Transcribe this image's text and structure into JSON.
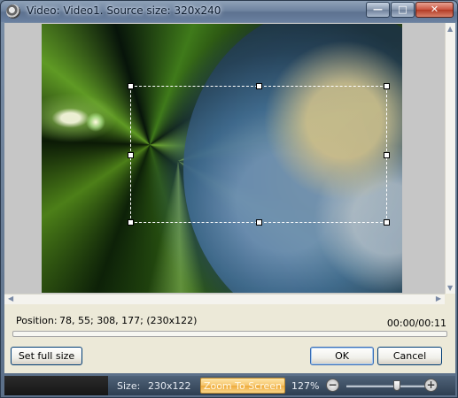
{
  "window": {
    "title": "Video: Video1. Source size: 320x240",
    "minimize_glyph": "—",
    "maximize_glyph": "□",
    "close_glyph": "✕"
  },
  "video": {
    "position_label": "Position:",
    "position_value": "78, 55; 308, 177; (230x122)",
    "time": "00:00/00:11",
    "progress": 0
  },
  "buttons": {
    "set_full_size": "Set full size",
    "ok": "OK",
    "cancel": "Cancel"
  },
  "statusbar": {
    "size_label": "Size:",
    "size_value": "230x122",
    "zoom_to_screen": "Zoom To Screen",
    "zoom_percent": "127%",
    "zoom_minus": "−",
    "zoom_plus": "+",
    "zoom_level": 0.62
  },
  "colors": {
    "titlebar": "#6f84a0",
    "dialog_bg": "#ece9d8",
    "zoom_button": "#f5c46a",
    "statusbar": "#3f5066"
  },
  "icons": {
    "app": "reel-icon",
    "scroll_up": "arrow-up-icon",
    "scroll_down": "arrow-down-icon",
    "scroll_left": "arrow-left-icon",
    "scroll_right": "arrow-right-icon"
  }
}
